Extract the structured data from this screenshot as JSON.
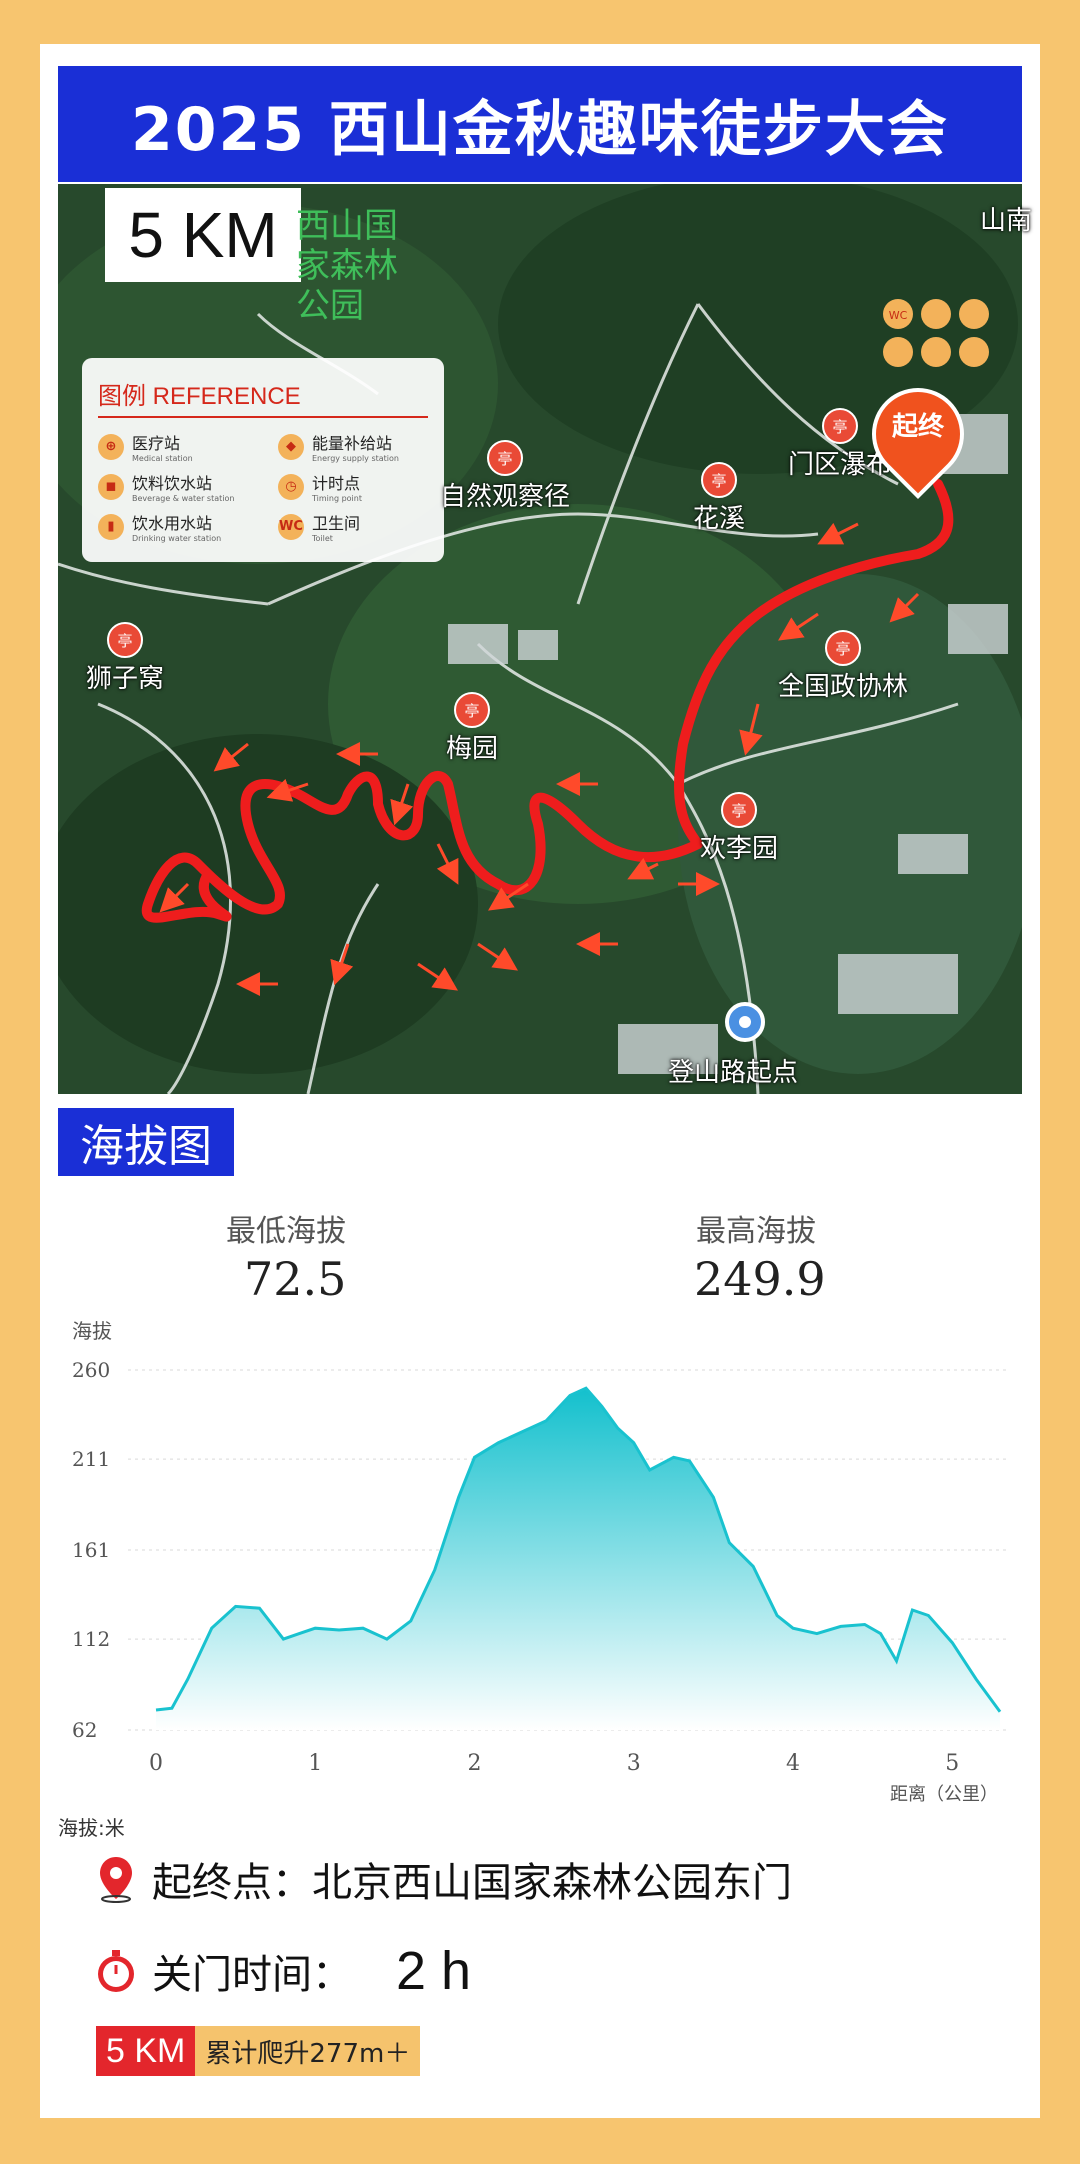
{
  "header": {
    "title": "2025 西山金秋趣味徒步大会"
  },
  "map": {
    "distance_label": "5 KM",
    "legend": {
      "title": "图例  REFERENCE",
      "items": [
        {
          "icon": "medical-icon",
          "glyph": "⊕",
          "label": "医疗站",
          "sub": "Medical station"
        },
        {
          "icon": "energy-icon",
          "glyph": "◆",
          "label": "能量补给站",
          "sub": "Energy supply station"
        },
        {
          "icon": "beverage-icon",
          "glyph": "◼",
          "label": "饮料饮水站",
          "sub": "Beverage & water station"
        },
        {
          "icon": "timing-icon",
          "glyph": "◷",
          "label": "计时点",
          "sub": "Timing point"
        },
        {
          "icon": "water-icon",
          "glyph": "▮",
          "label": "饮水用水站",
          "sub": "Drinking water station"
        },
        {
          "icon": "toilet-icon",
          "glyph": "WC",
          "label": "卫生间",
          "sub": "Toilet"
        }
      ]
    },
    "places": [
      "西山国家森林公园",
      "自然观察径",
      "花溪",
      "门区瀑布",
      "狮子窝",
      "全国政协林",
      "梅园",
      "欢李园",
      "登山路起点",
      "山南"
    ],
    "start_end_label": "起终",
    "route_color": "#ee1d1d"
  },
  "elevation": {
    "section_title": "海拔图",
    "min_label": "最低海拔",
    "min_value": "72.5",
    "max_label": "最高海拔",
    "max_value": "249.9",
    "unit_note": "海拔:米"
  },
  "chart_data": {
    "type": "area",
    "ylabel": "海拔",
    "xlabel": "距离（公里）",
    "y_ticks": [
      62,
      112,
      161,
      211,
      260
    ],
    "x_ticks": [
      0,
      1,
      2,
      3,
      4,
      5
    ],
    "ylim": [
      62,
      260
    ],
    "xlim": [
      -0.05,
      5.35
    ],
    "grid": true,
    "fill_color": "#19c2cf",
    "x": [
      0.0,
      0.1,
      0.2,
      0.35,
      0.5,
      0.65,
      0.8,
      0.9,
      1.0,
      1.15,
      1.3,
      1.45,
      1.6,
      1.75,
      1.9,
      2.0,
      2.15,
      2.3,
      2.45,
      2.6,
      2.7,
      2.8,
      2.9,
      3.0,
      3.1,
      3.25,
      3.35,
      3.5,
      3.6,
      3.75,
      3.9,
      4.0,
      4.15,
      4.3,
      4.45,
      4.55,
      4.65,
      4.75,
      4.85,
      5.0,
      5.15,
      5.3
    ],
    "y": [
      73,
      74,
      90,
      118,
      130,
      129,
      112,
      115,
      118,
      117,
      118,
      112,
      122,
      150,
      190,
      212,
      220,
      226,
      232,
      246,
      250,
      240,
      228,
      220,
      205,
      212,
      210,
      190,
      165,
      152,
      125,
      118,
      115,
      119,
      120,
      115,
      100,
      128,
      125,
      110,
      90,
      72
    ]
  },
  "info": {
    "start_label": "起终点：北京西山国家森林公园东门",
    "close_label": "关门时间：",
    "close_value": "2 h",
    "badge_km": "5 KM",
    "badge_climb": "累计爬升277m＋"
  }
}
